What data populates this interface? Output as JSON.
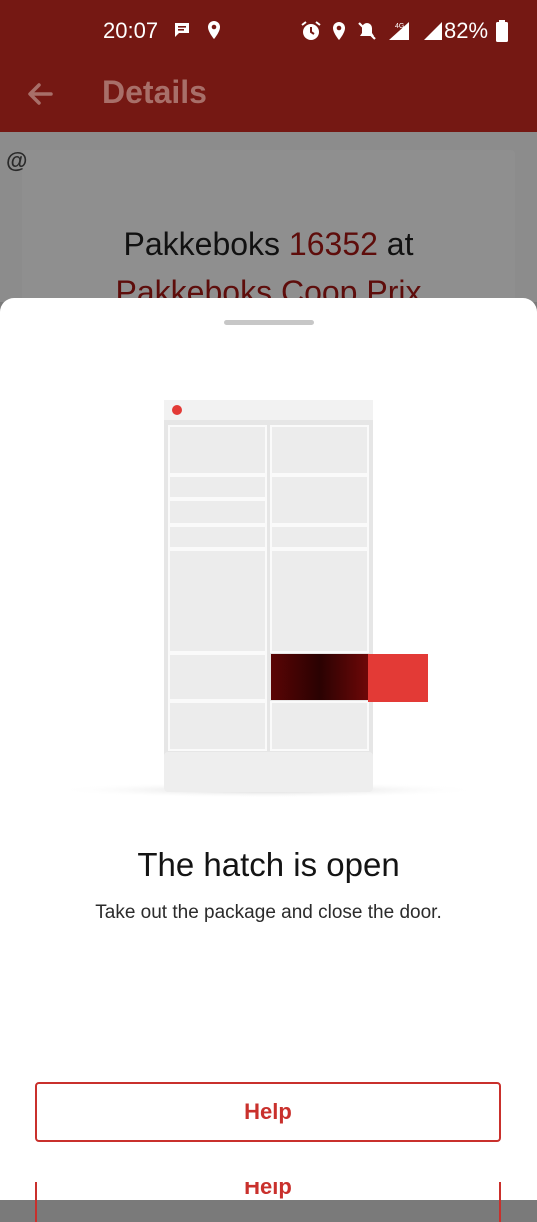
{
  "status_bar": {
    "time": "20:07",
    "network": "4G",
    "battery": "82%",
    "left_icons": [
      "chat-notification-icon",
      "location-icon"
    ],
    "right_icons": [
      "alarm-icon",
      "location-icon",
      "muted-icon",
      "signal-4g-icon",
      "signal-icon",
      "battery-icon"
    ]
  },
  "app_bar": {
    "title": "Details",
    "back_icon": "arrow-left-icon"
  },
  "background_page": {
    "title_prefix": "Pakkeboks ",
    "box_number": "16352",
    "title_mid": " at",
    "location": "Pakkeboks Coop Prix",
    "logo_text": "@"
  },
  "sheet": {
    "title": "The hatch is open",
    "subtitle": "Take out the package and close the door.",
    "help_label": "Help",
    "help_label_secondary": "Help"
  },
  "colors": {
    "brand": "#751813",
    "accent": "#c9302c",
    "open_hatch": "#e33a36"
  }
}
